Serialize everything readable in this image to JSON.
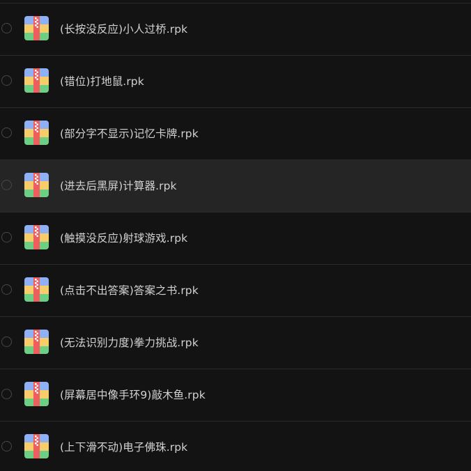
{
  "files": [
    {
      "name": "(长按没反应)小人过桥.rpk",
      "icon": "archive-icon",
      "highlighted": false
    },
    {
      "name": "(错位)打地鼠.rpk",
      "icon": "archive-icon",
      "highlighted": false
    },
    {
      "name": "(部分字不显示)记忆卡牌.rpk",
      "icon": "archive-icon",
      "highlighted": false
    },
    {
      "name": "(进去后黑屏)计算器.rpk",
      "icon": "archive-icon",
      "highlighted": true
    },
    {
      "name": "(触摸没反应)射球游戏.rpk",
      "icon": "archive-icon",
      "highlighted": false
    },
    {
      "name": "(点击不出答案)答案之书.rpk",
      "icon": "archive-icon",
      "highlighted": false
    },
    {
      "name": "(无法识别力度)拳力挑战.rpk",
      "icon": "archive-icon",
      "highlighted": false
    },
    {
      "name": "(屏幕居中像手环9)敲木鱼.rpk",
      "icon": "archive-icon",
      "highlighted": false
    },
    {
      "name": "(上下滑不动)电子佛珠.rpk",
      "icon": "archive-icon",
      "highlighted": false
    }
  ],
  "colors": {
    "background": "#131313",
    "row_highlight": "#252525",
    "divider": "#2c2c2c",
    "text": "#d2d2d2",
    "radio_border": "#474747",
    "icon_blue": "#8fb0f5",
    "icon_yellow": "#f7cd6b",
    "icon_green": "#6ccf84",
    "icon_zipper": "#ee5e5e"
  }
}
